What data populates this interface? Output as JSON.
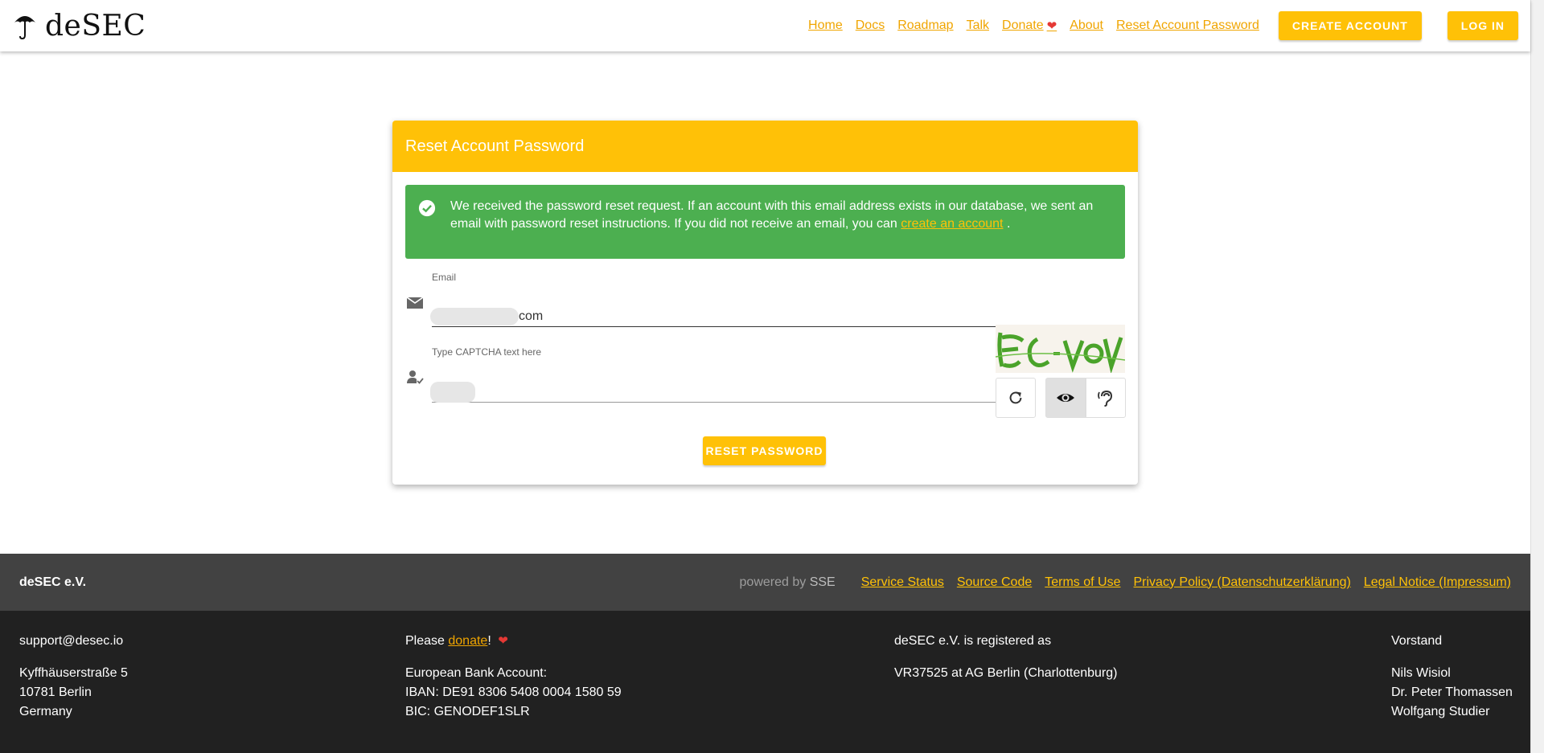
{
  "header": {
    "brand": "deSEC",
    "nav": [
      "Home",
      "Docs",
      "Roadmap",
      "Talk",
      "Donate",
      "About",
      "Reset Account Password"
    ],
    "create_account": "CREATE ACCOUNT",
    "log_in": "LOG IN"
  },
  "card": {
    "title": "Reset Account Password",
    "alert": {
      "text": "We received the password reset request. If an account with this email address exists in our database, we sent an email with password reset instructions. If you did not receive an email, you can",
      "link": "create an account",
      "end": "."
    },
    "email_label": "Email",
    "email_value_suffix": "com",
    "captcha_label": "Type CAPTCHA text here",
    "reset_button": "RESET PASSWORD"
  },
  "footer": {
    "brand": "deSEC e.V.",
    "powered_by": "powered by",
    "powered_name": "SSE",
    "links": [
      "Service Status",
      "Source Code",
      "Terms of Use",
      "Privacy Policy (Datenschutzerklärung)",
      "Legal Notice (Impressum)"
    ],
    "col1": [
      "support@desec.io",
      "Kyffhäuserstraße 5",
      "10781 Berlin",
      "Germany"
    ],
    "col2": {
      "please": "Please",
      "donate": "donate",
      "excl": "!",
      "bank": [
        "European Bank Account:",
        "IBAN: DE91 8306 5408 0004 1580 59",
        "BIC: GENODEF1SLR"
      ]
    },
    "col3": [
      "deSEC e.V. is registered as",
      "VR37525 at AG Berlin (Charlottenburg)"
    ],
    "col4": [
      "Vorstand",
      "Nils Wisiol",
      "Dr. Peter Thomassen",
      "Wolfgang Studier"
    ]
  },
  "colors": {
    "accent": "#ffc107",
    "success": "#4caf50",
    "footer_top": "#424242",
    "footer_bottom": "#212121"
  }
}
